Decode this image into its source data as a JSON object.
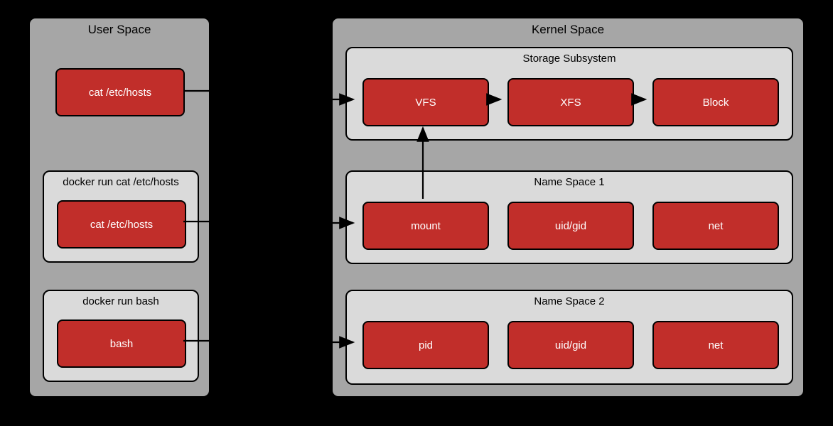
{
  "user_space": {
    "title": "User Space",
    "box1": "cat /etc/hosts",
    "sub1": {
      "title": "docker run cat /etc/hosts",
      "box": "cat /etc/hosts"
    },
    "sub2": {
      "title": "docker run bash",
      "box": "bash"
    }
  },
  "kernel_space": {
    "title": "Kernel Space",
    "storage": {
      "title": "Storage Subsystem",
      "box1": "VFS",
      "box2": "XFS",
      "box3": "Block"
    },
    "ns1": {
      "title": "Name Space 1",
      "box1": "mount",
      "box2": "uid/gid",
      "box3": "net"
    },
    "ns2": {
      "title": "Name Space 2",
      "box1": "pid",
      "box2": "uid/gid",
      "box3": "net"
    }
  }
}
